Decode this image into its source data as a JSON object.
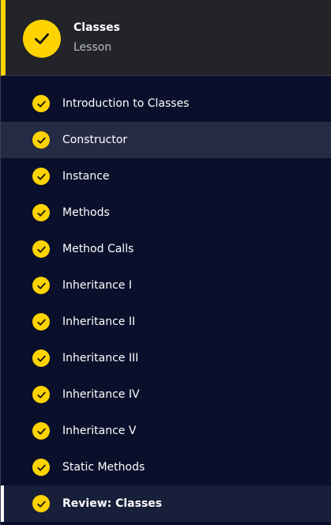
{
  "header": {
    "title": "Classes",
    "subtitle": "Lesson",
    "status_icon": "check-icon"
  },
  "colors": {
    "accent": "#ffd300",
    "background": "#0a0f2b",
    "header_background": "#232429",
    "hover_background": "#252b44"
  },
  "lessons": [
    {
      "label": "Introduction to Classes",
      "completed": true
    },
    {
      "label": "Constructor",
      "completed": true,
      "hovered": true
    },
    {
      "label": "Instance",
      "completed": true
    },
    {
      "label": "Methods",
      "completed": true
    },
    {
      "label": "Method Calls",
      "completed": true
    },
    {
      "label": "Inheritance I",
      "completed": true
    },
    {
      "label": "Inheritance II",
      "completed": true
    },
    {
      "label": "Inheritance III",
      "completed": true
    },
    {
      "label": "Inheritance IV",
      "completed": true
    },
    {
      "label": "Inheritance V",
      "completed": true
    },
    {
      "label": "Static Methods",
      "completed": true
    },
    {
      "label": "Review: Classes",
      "completed": true,
      "active": true
    }
  ]
}
